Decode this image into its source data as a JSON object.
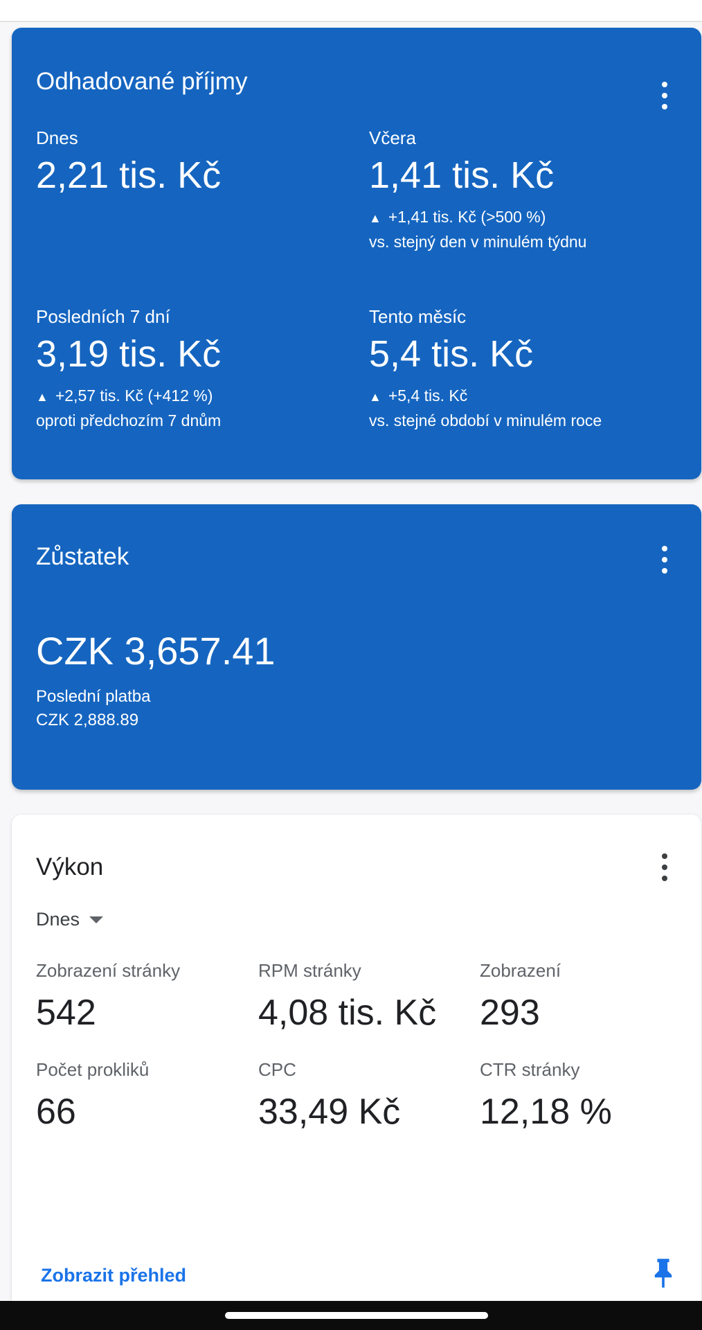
{
  "estimated_earnings": {
    "title": "Odhadované příjmy",
    "today": {
      "label": "Dnes",
      "value": "2,21 tis. Kč"
    },
    "yesterday": {
      "label": "Včera",
      "value": "1,41 tis. Kč",
      "change": "+1,41 tis. Kč (>500 %)",
      "compare": "vs. stejný den v minulém týdnu"
    },
    "last7": {
      "label": "Posledních 7 dní",
      "value": "3,19 tis. Kč",
      "change": "+2,57 tis. Kč (+412 %)",
      "compare": "oproti předchozím 7 dnům"
    },
    "this_month": {
      "label": "Tento měsíc",
      "value": "5,4 tis. Kč",
      "change": "+5,4 tis. Kč",
      "compare": "vs. stejné období v minulém roce"
    }
  },
  "balance": {
    "title": "Zůstatek",
    "value": "CZK 3,657.41",
    "last_payment_label": "Poslední platba",
    "last_payment_value": "CZK 2,888.89"
  },
  "performance": {
    "title": "Výkon",
    "period": "Dnes",
    "metrics": [
      {
        "label": "Zobrazení stránky",
        "value": "542"
      },
      {
        "label": "RPM stránky",
        "value": "4,08 tis. Kč"
      },
      {
        "label": "Zobrazení",
        "value": "293"
      },
      {
        "label": "Počet prokliků",
        "value": "66"
      },
      {
        "label": "CPC",
        "value": "33,49 Kč"
      },
      {
        "label": "CTR stránky",
        "value": "12,18 %"
      }
    ],
    "view_report": "Zobrazit přehled"
  },
  "colors": {
    "card_blue": "#1565c0",
    "link_blue": "#1a73e8"
  },
  "icons": {
    "more": "more-vert-icon",
    "pin": "pin-icon",
    "dropdown": "arrow-drop-down-icon",
    "trend": "arrow-up-icon"
  }
}
